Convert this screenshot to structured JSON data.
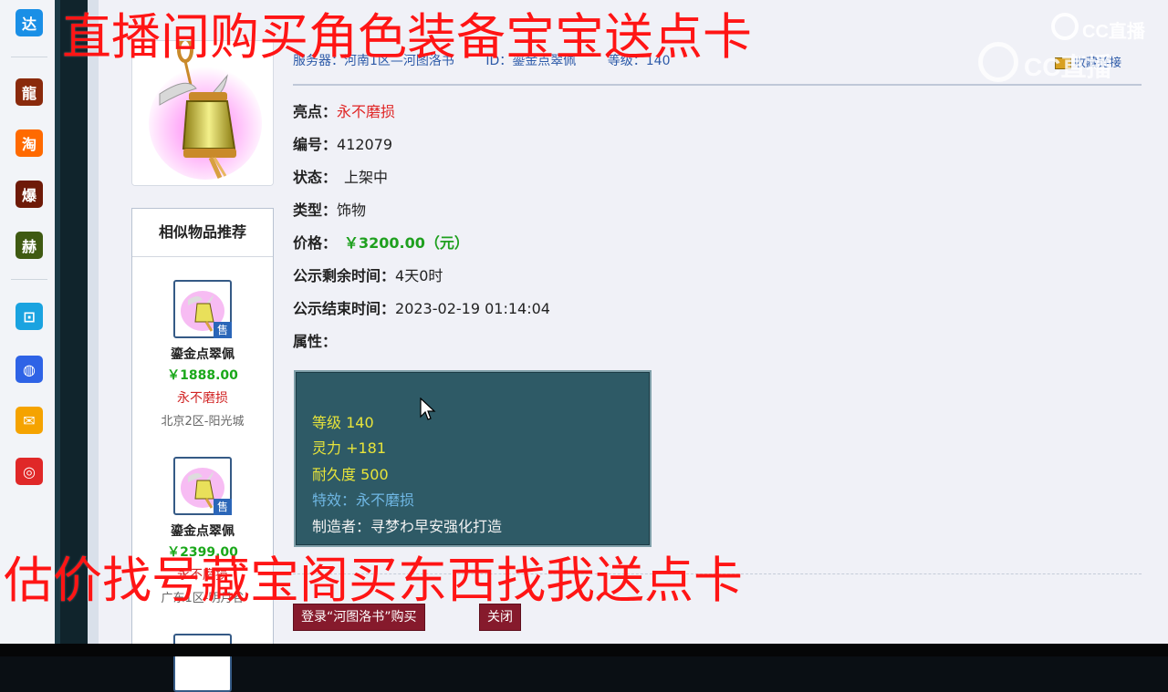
{
  "taskbar": {
    "icons": [
      {
        "name": "da-icon",
        "glyph": "达",
        "color": "#1a8fe6"
      },
      {
        "name": "game-long-icon",
        "glyph": "龍",
        "color": "#9b2a0c"
      },
      {
        "name": "taobao-icon",
        "glyph": "淘",
        "color": "#ff6a00"
      },
      {
        "name": "game-bao-icon",
        "glyph": "爆",
        "color": "#7a1c0a"
      },
      {
        "name": "game-green-icon",
        "glyph": "赫",
        "color": "#3f5a12"
      },
      {
        "name": "bilibili-icon",
        "glyph": "⊡",
        "color": "#1aa3e0"
      },
      {
        "name": "baidu-icon",
        "glyph": "◍",
        "color": "#2e63e6"
      },
      {
        "name": "mail-icon",
        "glyph": "✉",
        "color": "#f5a300"
      },
      {
        "name": "netease-icon",
        "glyph": "◎",
        "color": "#e02828"
      }
    ]
  },
  "header": {
    "server": "服务器：河南1区—河图洛书",
    "id": "ID：鎏金点翠佩",
    "level": "等级：140",
    "fav_link": "收藏链接"
  },
  "details": {
    "highlight_label": "亮点：",
    "highlight_value": "永不磨损",
    "number_label": "编号：",
    "number_value": "412079",
    "status_label": "状态：",
    "status_value": "上架中",
    "type_label": "类型：",
    "type_value": "饰物",
    "price_label": "价格：",
    "price_value": "￥3200.00（元）",
    "remain_label": "公示剩余时间：",
    "remain_value": "4天0时",
    "end_label": "公示结束时间：",
    "end_value": "2023-02-19 01:14:04",
    "attr_label": "属性："
  },
  "properties": {
    "level": "等级 140",
    "spirit": "灵力 +181",
    "durability": "耐久度 500",
    "effect": "特效：永不磨损",
    "maker": "制造者：寻梦わ早安强化打造"
  },
  "similar": {
    "title": "相似物品推荐",
    "sale_badge": "售",
    "items": [
      {
        "name": "鎏金点翠佩",
        "price": "￥1888.00",
        "tag": "永不磨损",
        "server": "北京2区-阳光城"
      },
      {
        "name": "鎏金点翠佩",
        "price": "￥2399.00",
        "tag": "永不磨损",
        "server": "广东1区-明月谷"
      }
    ]
  },
  "buttons": {
    "buy": "登录“河图洛书”购买",
    "close": "关闭"
  },
  "overlays": {
    "top_text": "直播间购买角色装备宝宝送点卡",
    "bottom_text": "估价找号藏宝阁买东西找我送点卡",
    "watermark": "CC直播"
  }
}
